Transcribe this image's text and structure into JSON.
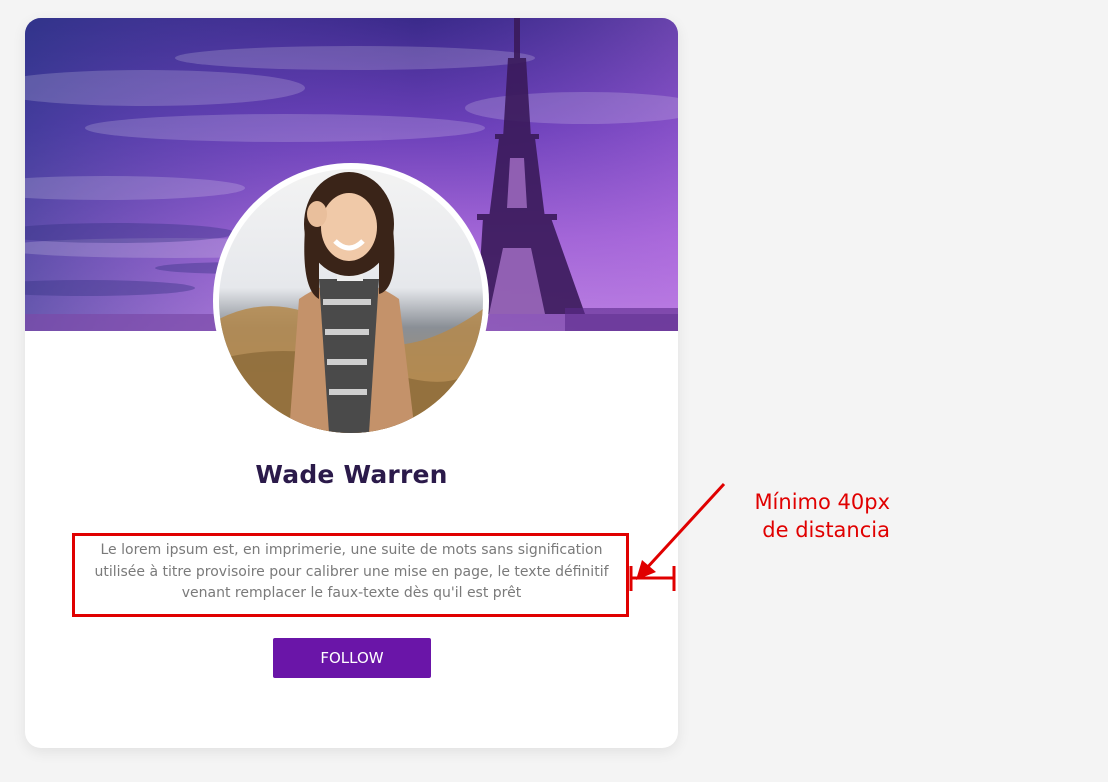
{
  "profile": {
    "name": "Wade Warren",
    "description": "Le lorem ipsum est, en imprimerie, une suite de mots sans signification utilisée à titre provisoire pour calibrer une mise en page, le texte définitif venant remplacer le faux-texte dès qu'il est prêt",
    "follow_label": "FOLLOW"
  },
  "annotation": {
    "line1": "Mínimo 40px",
    "line2": "de distancia"
  },
  "colors": {
    "accent": "#6a15a8",
    "annotation": "#e00000",
    "name": "#2b1a4a"
  }
}
